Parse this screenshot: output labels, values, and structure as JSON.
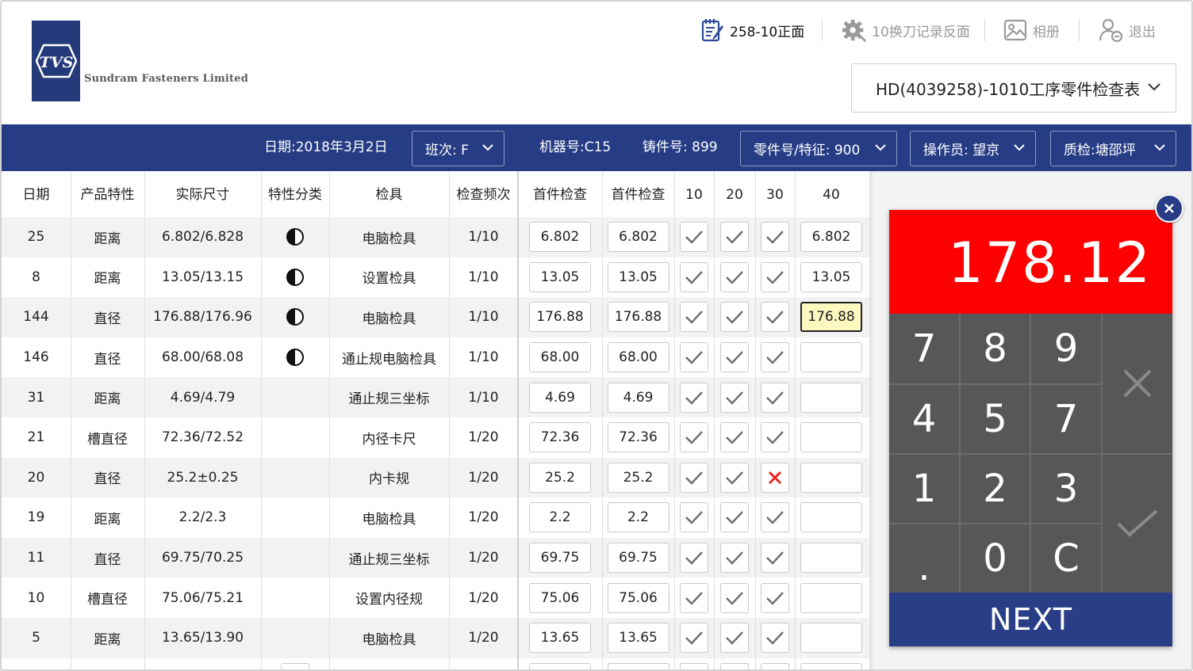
{
  "header": {
    "logo_text": "TVS",
    "company": "Sundram Fasteners Limited",
    "menu": [
      {
        "label": "258-10正面",
        "icon": "notepad-icon",
        "active": true
      },
      {
        "label": "10换刀记录反面",
        "icon": "gear-icon",
        "active": false
      },
      {
        "label": "相册",
        "icon": "image-icon",
        "active": false
      },
      {
        "label": "退出",
        "icon": "logout-icon",
        "active": false
      }
    ],
    "form_select": "HD(4039258)-1010工序零件检查表"
  },
  "info_bar": {
    "date": "日期:2018年3月2日",
    "shift": "班次: F",
    "machine": "机器号:C15",
    "casting": "铸件号: 899",
    "part": "零件号/特征: 900",
    "operator": "操作员: 望京",
    "qc": "质检:塘邵坪"
  },
  "table": {
    "headers": [
      "日期",
      "产品特性",
      "实际尺寸",
      "特性分类",
      "检具",
      "检查频次",
      "首件检查",
      "首件检查",
      "10",
      "20",
      "30",
      "40"
    ],
    "rows": [
      {
        "date": "25",
        "feature": "距离",
        "size": "6.802/6.828",
        "cls": true,
        "gauge": "电脑检具",
        "freq": "1/10",
        "f1": "6.802",
        "f2": "6.802",
        "c10": "ok",
        "c20": "ok",
        "c30": "ok",
        "v40": "6.802"
      },
      {
        "date": "8",
        "feature": "距离",
        "size": "13.05/13.15",
        "cls": true,
        "gauge": "设置检具",
        "freq": "1/10",
        "f1": "13.05",
        "f2": "13.05",
        "c10": "ok",
        "c20": "ok",
        "c30": "ok",
        "v40": "13.05"
      },
      {
        "date": "144",
        "feature": "直径",
        "size": "176.88/176.96",
        "cls": true,
        "gauge": "电脑检具",
        "freq": "1/10",
        "f1": "176.88",
        "f2": "176.88",
        "c10": "ok",
        "c20": "ok",
        "c30": "ok",
        "v40": "176.88",
        "hl": true
      },
      {
        "date": "146",
        "feature": "直径",
        "size": "68.00/68.08",
        "cls": true,
        "gauge": "通止规电脑检具",
        "freq": "1/10",
        "f1": "68.00",
        "f2": "68.00",
        "c10": "ok",
        "c20": "ok",
        "c30": "ok",
        "v40": ""
      },
      {
        "date": "31",
        "feature": "距离",
        "size": "4.69/4.79",
        "cls": false,
        "gauge": "通止规三坐标",
        "freq": "1/10",
        "f1": "4.69",
        "f2": "4.69",
        "c10": "ok",
        "c20": "ok",
        "c30": "ok",
        "v40": ""
      },
      {
        "date": "21",
        "feature": "槽直径",
        "size": "72.36/72.52",
        "cls": false,
        "gauge": "内径卡尺",
        "freq": "1/20",
        "f1": "72.36",
        "f2": "72.36",
        "c10": "ok",
        "c20": "ok",
        "c30": "ok",
        "v40": ""
      },
      {
        "date": "20",
        "feature": "直径",
        "size": "25.2±0.25",
        "cls": false,
        "gauge": "内卡规",
        "freq": "1/20",
        "f1": "25.2",
        "f2": "25.2",
        "c10": "ok",
        "c20": "ok",
        "c30": "ng",
        "v40": ""
      },
      {
        "date": "19",
        "feature": "距离",
        "size": "2.2/2.3",
        "cls": false,
        "gauge": "电脑检具",
        "freq": "1/20",
        "f1": "2.2",
        "f2": "2.2",
        "c10": "ok",
        "c20": "ok",
        "c30": "ok",
        "v40": ""
      },
      {
        "date": "11",
        "feature": "直径",
        "size": "69.75/70.25",
        "cls": false,
        "gauge": "通止规三坐标",
        "freq": "1/20",
        "f1": "69.75",
        "f2": "69.75",
        "c10": "ok",
        "c20": "ok",
        "c30": "ok",
        "v40": ""
      },
      {
        "date": "10",
        "feature": "槽直径",
        "size": "75.06/75.21",
        "cls": false,
        "gauge": "设置内径规",
        "freq": "1/20",
        "f1": "75.06",
        "f2": "75.06",
        "c10": "ok",
        "c20": "ok",
        "c30": "ok",
        "v40": ""
      },
      {
        "date": "5",
        "feature": "距离",
        "size": "13.65/13.90",
        "cls": false,
        "gauge": "电脑检具",
        "freq": "1/20",
        "f1": "13.65",
        "f2": "13.65",
        "c10": "ok",
        "c20": "ok",
        "c30": "ok",
        "v40": ""
      }
    ]
  },
  "keypad": {
    "display": "178.12",
    "keys": [
      "7",
      "8",
      "9",
      "4",
      "5",
      "7",
      "1",
      "2",
      "3",
      ".",
      "0",
      "C"
    ],
    "next": "NEXT"
  },
  "colors": {
    "brand_blue": "#263d85",
    "display_red": "#ff0000",
    "keypad_gray": "#575757",
    "highlight": "#fdf8bf",
    "error_red": "#e8231c"
  }
}
